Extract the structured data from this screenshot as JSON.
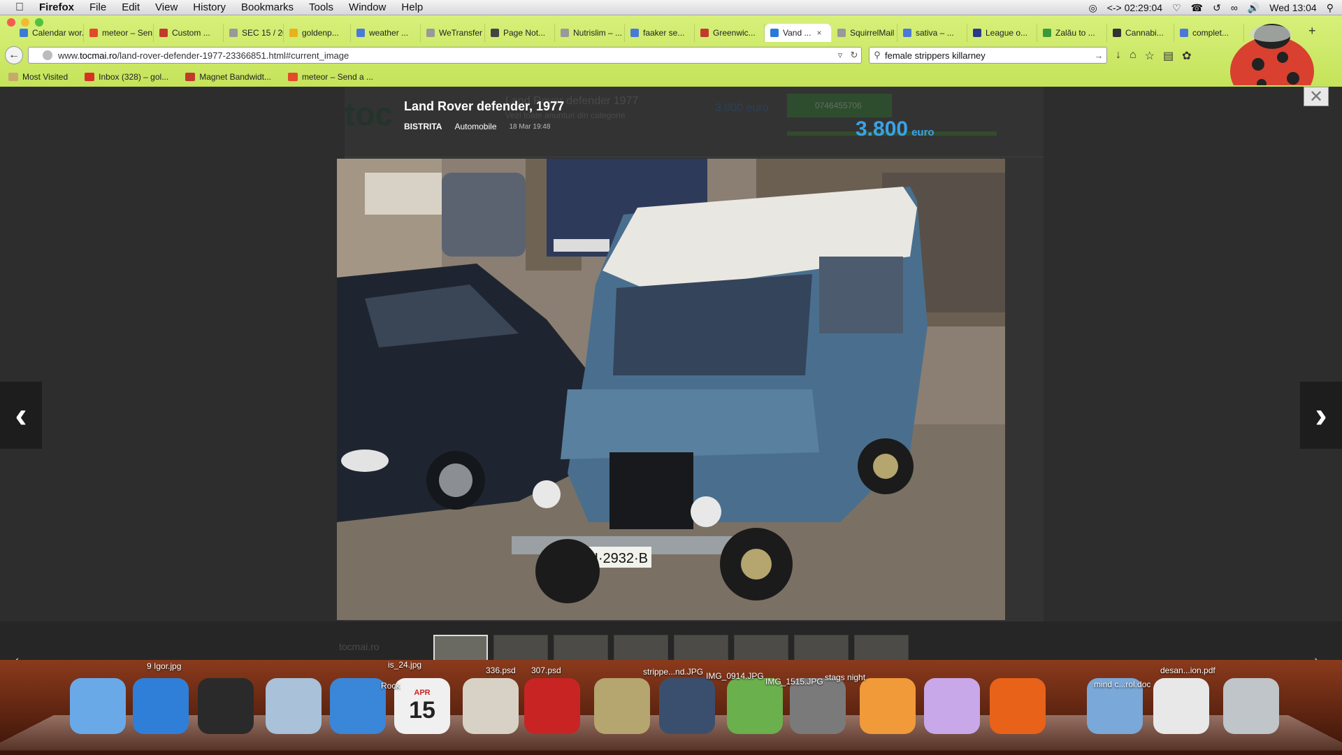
{
  "menubar": {
    "app": "Firefox",
    "items": [
      "File",
      "Edit",
      "View",
      "History",
      "Bookmarks",
      "Tools",
      "Window",
      "Help"
    ],
    "clock": "Wed 13:04",
    "timer": "02:29:04"
  },
  "tabs": [
    {
      "label": "Calendar wor...",
      "color": "#3b7bd8"
    },
    {
      "label": "meteor – Sen...",
      "color": "#e24a2a"
    },
    {
      "label": "Custom ...",
      "color": "#c23a2b"
    },
    {
      "label": "SEC 15 / 20",
      "color": "#999999"
    },
    {
      "label": "goldenp...",
      "color": "#e8b21b"
    },
    {
      "label": "weather ...",
      "color": "#4a7ad8"
    },
    {
      "label": "WeTransfer",
      "color": "#999999"
    },
    {
      "label": "Page Not...",
      "color": "#444444"
    },
    {
      "label": "Nutrislim – ...",
      "color": "#999999"
    },
    {
      "label": "faaker se...",
      "color": "#4a7ad8"
    },
    {
      "label": "Greenwic...",
      "color": "#c23a2b"
    },
    {
      "label": "Vand ...",
      "color": "#2a7ad8",
      "active": true
    },
    {
      "label": "SquirrelMail",
      "color": "#999999"
    },
    {
      "label": "sativa – ...",
      "color": "#4a7ad8"
    },
    {
      "label": "League o...",
      "color": "#2a3a8a"
    },
    {
      "label": "Zalău to ...",
      "color": "#3a9a3a"
    },
    {
      "label": "Cannabi...",
      "color": "#333333"
    },
    {
      "label": "complet...",
      "color": "#4a7ad8"
    }
  ],
  "nav": {
    "url_prefix": "www.",
    "url_domain": "tocmai.ro",
    "url_path": "/land-rover-defender-1977-23366851.html#current_image",
    "search_value": "female strippers killarney"
  },
  "bookmarks": [
    {
      "label": "Most Visited",
      "icon": "folder-icon",
      "color": "#c9a96a"
    },
    {
      "label": "Inbox (328) – gol...",
      "icon": "gmail-icon",
      "color": "#d93025"
    },
    {
      "label": "Magnet Bandwidt...",
      "icon": "magnet-icon",
      "color": "#c23a2b"
    },
    {
      "label": "meteor – Send a ...",
      "icon": "meteor-icon",
      "color": "#e24a2a"
    }
  ],
  "listing": {
    "title": "Land Rover defender, 1977",
    "location": "BISTRITA",
    "category": "Automobile",
    "date": "18 Mar 19:48",
    "price_amount": "3.800",
    "price_currency": "euro",
    "bg_logo": "toc",
    "bg_title": "Land Rover defender 1977",
    "bg_sub": "Vezi toate anunturi din categorie",
    "bg_price": "3.800 euro",
    "bg_phone": "0746455706",
    "plate": "CU·2932·B",
    "active_thumb": 0,
    "thumb_count": 8,
    "strip_logo": "tocmai.ro"
  },
  "dock": {
    "labels": [
      {
        "text": "9 Igor.jpg"
      },
      {
        "text": "Rock"
      },
      {
        "text": "is_24.jpg"
      },
      {
        "text": "336.psd"
      },
      {
        "text": "307.psd"
      },
      {
        "text": "strippe...nd.JPG"
      },
      {
        "text": "IMG_0914.JPG"
      },
      {
        "text": "IMG_1515.JPG"
      },
      {
        "text": "stags night"
      },
      {
        "text": "mind c...rol.doc"
      },
      {
        "text": "desan...ion.pdf"
      }
    ],
    "calendar_month": "APR",
    "calendar_day": "15"
  }
}
